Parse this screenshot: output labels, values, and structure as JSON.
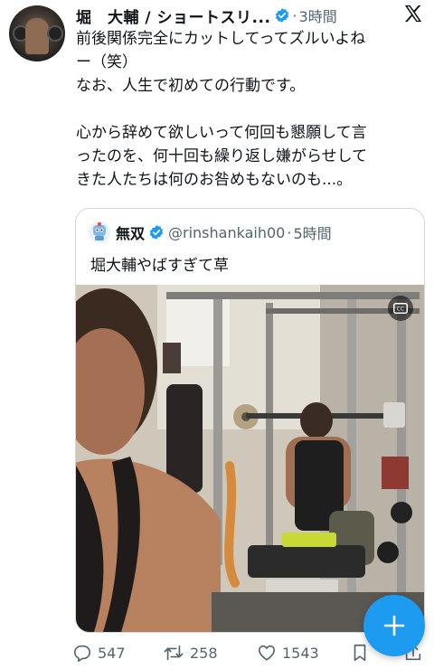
{
  "tweet": {
    "author_name": "堀　大輔 / ショートスリ...",
    "time": "3時間",
    "body": "前後関係完全にカットしてってズルいよね\nー（笑）\nなお、人生で初めての行動です。\n\n心から辞めて欲しいって何回も懇願して言\nったのを、何十回も繰り返し嫌がらせして\nきた人たちは何のお咎めもないのも...。"
  },
  "quote": {
    "author_name": "無双",
    "handle": "@rinshankaih00",
    "time": "5時間",
    "text": "堀大輔やばすぎて草"
  },
  "actions": {
    "replies": "547",
    "retweets": "258",
    "likes": "1543"
  },
  "icons": {
    "verified": "verified-badge-icon",
    "x_logo": "x-logo-icon",
    "reply": "reply-icon",
    "retweet": "retweet-icon",
    "like": "heart-icon",
    "bookmark": "bookmark-icon",
    "share": "share-icon",
    "compose": "plus-icon",
    "captions": "closed-captions-icon"
  },
  "colors": {
    "accent": "#1d9bf0",
    "text": "#0f1419",
    "secondary": "#536471",
    "border": "#cfd9de"
  }
}
